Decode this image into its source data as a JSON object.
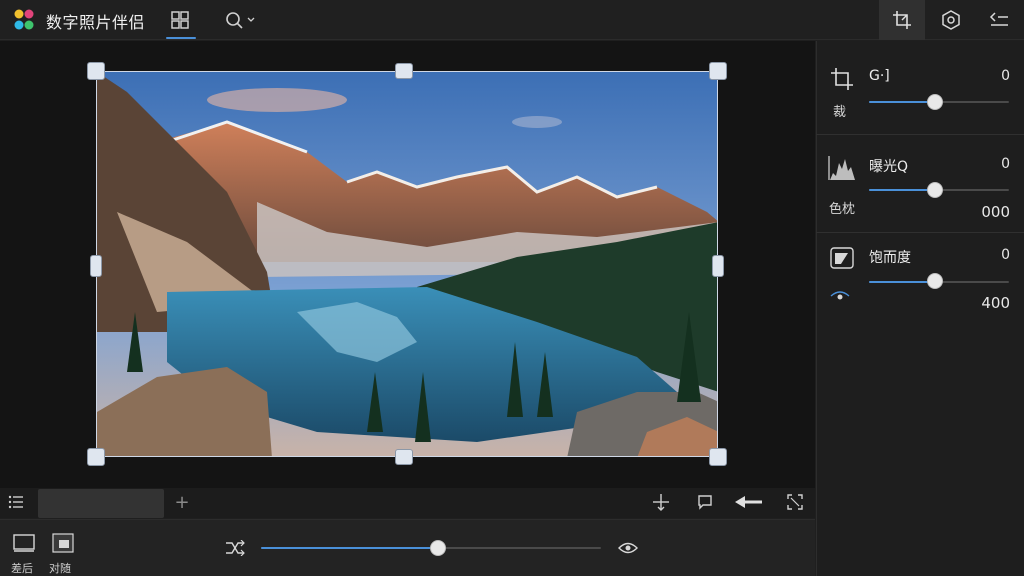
{
  "app": {
    "title": "数字照片伴侣"
  },
  "toolbar": {
    "icons": [
      "windows-grid-icon",
      "search-icon",
      "chevron-down-icon"
    ]
  },
  "right_toolbar": {
    "icons": [
      "crop-adjust-icon",
      "settings-hex-icon",
      "list-adjust-icon"
    ]
  },
  "photo": {
    "description_icon": "mountain-lake-image"
  },
  "filmstrip": {
    "add_label": "+"
  },
  "bottom": {
    "before_after_label": "差后",
    "compare_label": "对随"
  },
  "panel": {
    "crop": {
      "label": "裁",
      "name": "G·]",
      "value": "0",
      "level": 0.5
    },
    "color": {
      "name": "曝光Q",
      "sub_label": "色枕",
      "value": "0",
      "extra_value": "000",
      "level": 0.5
    },
    "saturation": {
      "name": "饱而度",
      "value": "0",
      "extra_value": "400",
      "level": 0.5
    }
  },
  "colors": {
    "accent": "#4a90d9",
    "background": "#1f1f1f",
    "canvas": "#141414"
  }
}
